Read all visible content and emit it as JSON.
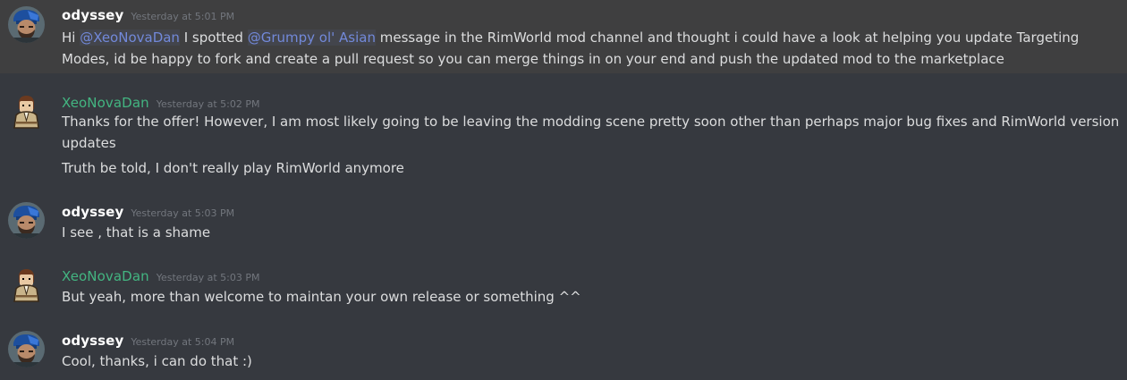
{
  "messages": [
    {
      "author": "odyssey",
      "timestamp": "Yesterday at 5:01 PM",
      "line1_pre": "Hi ",
      "mention1": "@XeoNovaDan",
      "line1_mid": " I spotted ",
      "mention2": "@Grumpy ol' Asian",
      "line1_post": " message in the RimWorld mod channel and thought i could have a look at helping you update Targeting",
      "line2": "Modes, id be happy to fork and create a pull request so you can merge things in on your end and push the updated mod to the marketplace"
    },
    {
      "author": "XeoNovaDan",
      "timestamp": "Yesterday at 5:02 PM",
      "line1": "Thanks for the offer! However, I am most likely going to be leaving the modding scene pretty soon other than perhaps major bug fixes and RimWorld version",
      "line2": "updates",
      "line3": "Truth be told, I don't really play RimWorld anymore"
    },
    {
      "author": "odyssey",
      "timestamp": "Yesterday at 5:03 PM",
      "line1": "I see , that is a shame"
    },
    {
      "author": "XeoNovaDan",
      "timestamp": "Yesterday at 5:03 PM",
      "line1": "But yeah, more than welcome to maintan your own release or something ^^"
    },
    {
      "author": "odyssey",
      "timestamp": "Yesterday at 5:04 PM",
      "line1": "Cool, thanks, i can do that :)"
    }
  ],
  "colors": {
    "background": "#36393f",
    "highlight": "#3f3f40",
    "username_odyssey": "#ffffff",
    "username_xeo": "#43b581",
    "mention": "#7289da",
    "text": "#dcddde",
    "timestamp": "#72767d"
  },
  "icons": {
    "odyssey_avatar": "bearded-man-blue-cap-avatar",
    "xeo_avatar": "pixel-art-colonist-avatar"
  }
}
